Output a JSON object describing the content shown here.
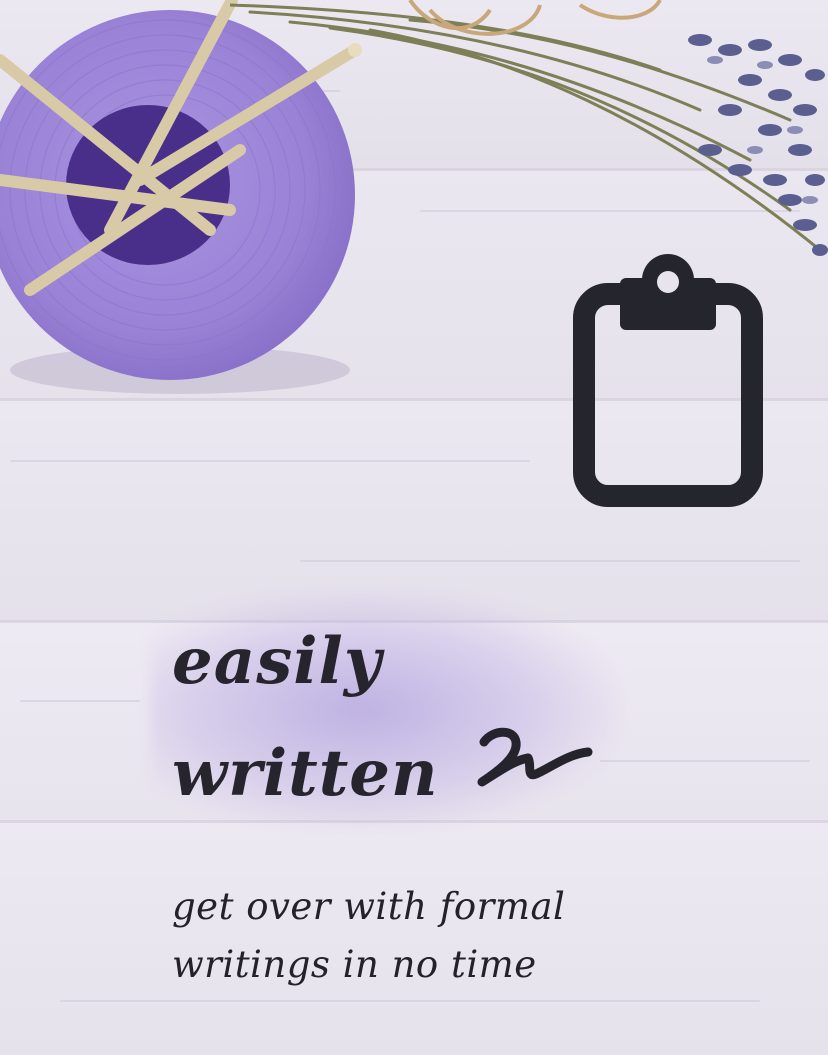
{
  "hero": {
    "headline_line1": "easily",
    "headline_line2": "written",
    "subtitle_line1": "get over with formal",
    "subtitle_line2": "writings in no time"
  },
  "icons": {
    "feature_icon": "clipboard-icon",
    "flourish": "squiggle-icon"
  },
  "colors": {
    "text": "#26242c",
    "accent_purple": "#9d86d6",
    "background": "#e8e4ee"
  }
}
